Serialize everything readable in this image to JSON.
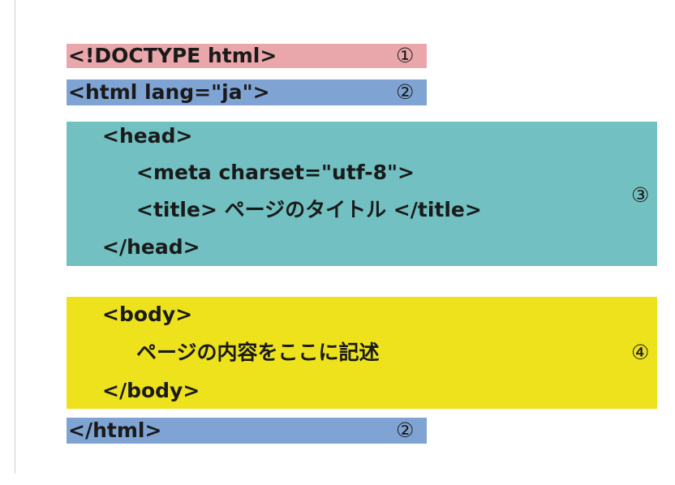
{
  "colors": {
    "doctype": "#eaa7ab",
    "html": "#7fa4d4",
    "head": "#72c0c1",
    "body": "#ede21c",
    "text": "#1a1a1a"
  },
  "doctype": {
    "code": "<!DOCTYPE html>",
    "marker": "①"
  },
  "html_open": {
    "code": "<html lang=\"ja\">",
    "marker": "②"
  },
  "head": {
    "lines": [
      "<head>",
      "<meta charset=\"utf-8\">",
      "<title> ページのタイトル </title>",
      "</head>"
    ],
    "marker": "③"
  },
  "body": {
    "lines": [
      "<body>",
      "ページの内容をここに記述",
      "</body>"
    ],
    "marker": "④"
  },
  "html_close": {
    "code": "</html>",
    "marker": "②"
  }
}
